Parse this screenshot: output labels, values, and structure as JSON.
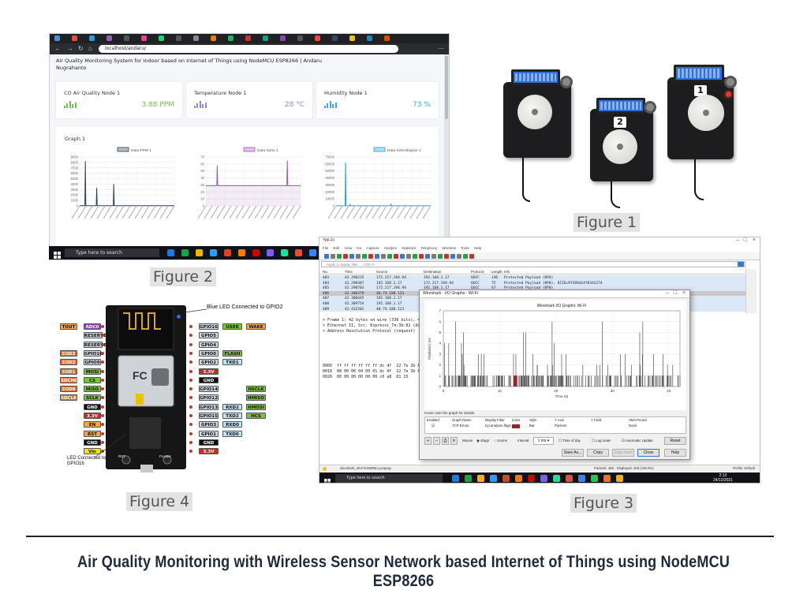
{
  "figure2": {
    "caption": "Figure 2",
    "url": "localhost/andaru/",
    "page_title": "Air Quality Monitoring System for Indoor based on Internet of Things using NodeMCU ESP8266 | Andaru Nugrahanto",
    "cards": [
      {
        "label": "CO Air Quality Node 1",
        "value": "3.88 PPM"
      },
      {
        "label": "Temperature Node 1",
        "value": "28 °C"
      },
      {
        "label": "Humidity Node 1",
        "value": "73 %"
      }
    ],
    "graph_panel_title": "Graph 1",
    "taskbar_search": "Type here to search"
  },
  "chart_data": [
    {
      "type": "line",
      "legend": "Data PPM 1",
      "color": "#2c3e50",
      "ylim": [
        0,
        9000
      ],
      "yticks": [
        0,
        1000,
        2000,
        3000,
        4000,
        5000,
        6000,
        7000,
        8000,
        9000
      ],
      "spikes": [
        [
          0.06,
          8200
        ],
        [
          0.18,
          3300
        ],
        [
          0.36,
          4000
        ]
      ],
      "baseline": 30
    },
    {
      "type": "line",
      "legend": "Data Suhu 1",
      "color": "#9b59b6",
      "ylim": [
        0,
        70
      ],
      "yticks": [
        0,
        10,
        20,
        30,
        40,
        50,
        60,
        70
      ],
      "spikes": [
        [
          0.12,
          58
        ],
        [
          0.86,
          65
        ]
      ],
      "baseline": 29
    },
    {
      "type": "line",
      "legend": "Data Kelembapan 1",
      "color": "#3498db",
      "ylim": [
        0,
        70000
      ],
      "yticks": [
        0,
        10000,
        20000,
        30000,
        40000,
        50000,
        60000,
        70000
      ],
      "spikes": [
        [
          0.1,
          62000
        ],
        [
          0.15,
          2000
        ],
        [
          0.58,
          3000
        ]
      ],
      "baseline": 80
    },
    {
      "type": "bar",
      "title": "Wireshark I/O Graphs: Wi-Fi",
      "ylabel": "Packets/1 ms",
      "xlabel": "Time (s)",
      "ylim": [
        0,
        7
      ],
      "xlim": [
        0,
        42
      ],
      "xticks": [
        0,
        10,
        20,
        30,
        40
      ],
      "yticks": [
        0,
        1,
        2,
        3,
        4,
        5,
        6,
        7
      ]
    }
  ],
  "figure1": {
    "caption": "Figure 1",
    "node_numbers": [
      "2",
      "1"
    ]
  },
  "figure3": {
    "caption": "Figure 3",
    "window_title": "*Wi-Fi",
    "menu": [
      "File",
      "Edit",
      "View",
      "Go",
      "Capture",
      "Analyze",
      "Statistics",
      "Telephony",
      "Wireless",
      "Tools",
      "Help"
    ],
    "filter_placeholder": "Apply a display filter ... <Ctrl-/>",
    "columns": [
      "No.",
      "Time",
      "Source",
      "Destination",
      "Protocol",
      "Length",
      "Info"
    ],
    "packets": [
      [
        "403",
        "42.290225",
        "172.217.194.94",
        "192.168.1.17",
        "QUIC",
        "146",
        "Protected Payload (KP0)"
      ],
      [
        "404",
        "42.290387",
        "192.168.1.17",
        "172.217.194.94",
        "QUIC",
        "75",
        "Protected Payload (KP0), DCID=9f389d24f8342274"
      ],
      [
        "405",
        "42.290703",
        "172.217.194.94",
        "192.168.1.17",
        "QUIC",
        "67",
        "Protected Payload (KP0)"
      ],
      [
        "406",
        "42.300379",
        "40.74.108.123",
        "",
        "",
        "",
        ""
      ],
      [
        "407",
        "42.300445",
        "192.168.1.17",
        "",
        "",
        "",
        ""
      ],
      [
        "408",
        "42.309754",
        "192.168.1.17",
        "",
        "",
        "",
        ""
      ],
      [
        "409",
        "42.432201",
        "40.74.108.123",
        "",
        "",
        "",
        ""
      ]
    ],
    "details": [
      "Frame 1: 42 bytes on wire (336 bits), 42",
      "Ethernet II, Src: Espressi_7e:3b:82 (dc",
      "Address Resolution Protocol (request)"
    ],
    "hex": [
      "0000  ff ff ff ff ff ff dc 4f  22 7e 3b 82",
      "0010  08 00 06 04 00 01 dc 4f  22 7e 3b 82",
      "0020  00 00 00 00 00 00 c0 a8  01 15"
    ],
    "io_window_title": "Wireshark · I/O Graphs · Wi-Fi",
    "hover_hint": "Hover over the graph for details.",
    "table_headers": [
      "Enabled",
      "Graph Name",
      "Display Filter",
      "Color",
      "Style",
      "Y Axis",
      "Y Field",
      "SMA Period"
    ],
    "table_row": {
      "name": "TCP Errors",
      "filter": "tcp.analysis.flags",
      "style": "Bar",
      "yaxis": "Packets",
      "sma": "None"
    },
    "controls": {
      "mouse": "Mouse",
      "drags": "drags",
      "zooms": "zooms",
      "interval_label": "Interval",
      "interval": "1 ms",
      "time_of_day": "Time of day",
      "log_scale": "Log scale",
      "auto_update": "Automatic Update",
      "reset": "Reset"
    },
    "buttons": [
      "Save As...",
      "Copy",
      "Copy from",
      "Close",
      "Help"
    ],
    "status_file": "wireshark_Wi-FiANWRE1.pcapng",
    "status_packets": "Packets: 458 · Displayed: 458 (100.0%)",
    "status_profile": "Profile: Default",
    "taskbar_search": "Type here to search",
    "clock_time": "2:13",
    "clock_date": "24/12/2021"
  },
  "figure4": {
    "caption": "Figure 4",
    "annot_blue_led": "Blue LED Connected to GPIO2",
    "annot_led16": "LED Connected to GPIO16",
    "left_pins": [
      {
        "labels": [
          "TOUT",
          "ADC0"
        ],
        "colors": [
          "#f2a64b",
          "#8e44ad"
        ]
      },
      {
        "labels": [
          "RESERVED"
        ],
        "colors": [
          "#cfd8e3"
        ]
      },
      {
        "labels": [
          "RESERVED"
        ],
        "colors": [
          "#cfd8e3"
        ]
      },
      {
        "labels": [
          "SDD3",
          "GPIO10"
        ],
        "colors": [
          "#e56a2c",
          "#cfd8e3"
        ]
      },
      {
        "labels": [
          "SDD2",
          "GPIO9"
        ],
        "colors": [
          "#e56a2c",
          "#cfd8e3"
        ]
      },
      {
        "labels": [
          "SDD1",
          "MOSI"
        ],
        "colors": [
          "#e56a2c",
          "#7ac143"
        ]
      },
      {
        "labels": [
          "SDCMD",
          "CS"
        ],
        "colors": [
          "#e56a2c",
          "#7ac143"
        ]
      },
      {
        "labels": [
          "SDD0",
          "MISO"
        ],
        "colors": [
          "#e56a2c",
          "#7ac143"
        ]
      },
      {
        "labels": [
          "SDCLK",
          "SCLK"
        ],
        "colors": [
          "#e56a2c",
          "#7ac143"
        ]
      },
      {
        "labels": [
          "GND"
        ],
        "colors": [
          "#111111"
        ]
      },
      {
        "labels": [
          "3.3V"
        ],
        "colors": [
          "#d8261c"
        ]
      },
      {
        "labels": [
          "EN"
        ],
        "colors": [
          "#f2a64b"
        ]
      },
      {
        "labels": [
          "RST"
        ],
        "colors": [
          "#f2a64b"
        ]
      },
      {
        "labels": [
          "GND"
        ],
        "colors": [
          "#111111"
        ]
      },
      {
        "labels": [
          "Vin"
        ],
        "colors": [
          "#f2e600"
        ]
      }
    ],
    "right_pins": [
      {
        "labels": [
          "GPIO16",
          "USER",
          "WAKE"
        ],
        "colors": [
          "#cfd8e3",
          "#7ac143",
          "#f2a64b"
        ]
      },
      {
        "labels": [
          "GPIO5"
        ],
        "colors": [
          "#cfd8e3"
        ]
      },
      {
        "labels": [
          "GPIO4"
        ],
        "colors": [
          "#cfd8e3"
        ]
      },
      {
        "labels": [
          "GPIO0",
          "FLASH"
        ],
        "colors": [
          "#cfd8e3",
          "#7ac143"
        ]
      },
      {
        "labels": [
          "GPIO2",
          "TXD1"
        ],
        "colors": [
          "#cfd8e3",
          "#bfe3f7"
        ]
      },
      {
        "labels": [
          "3.3V"
        ],
        "colors": [
          "#d8261c"
        ]
      },
      {
        "labels": [
          "GND"
        ],
        "colors": [
          "#111111"
        ]
      },
      {
        "labels": [
          "GPIO14",
          "",
          "HSCLK"
        ],
        "colors": [
          "#cfd8e3",
          "",
          "#7ac143"
        ]
      },
      {
        "labels": [
          "GPIO12",
          "",
          "HMISO"
        ],
        "colors": [
          "#cfd8e3",
          "",
          "#7ac143"
        ]
      },
      {
        "labels": [
          "GPIO13",
          "RXD2",
          "HMOSI"
        ],
        "colors": [
          "#cfd8e3",
          "#bfe3f7",
          "#7ac143"
        ]
      },
      {
        "labels": [
          "GPIO15",
          "TXD2",
          "HCS"
        ],
        "colors": [
          "#cfd8e3",
          "#bfe3f7",
          "#7ac143"
        ]
      },
      {
        "labels": [
          "GPIO3",
          "RXD0"
        ],
        "colors": [
          "#cfd8e3",
          "#bfe3f7"
        ]
      },
      {
        "labels": [
          "GPIO1",
          "TXD0"
        ],
        "colors": [
          "#cfd8e3",
          "#bfe3f7"
        ]
      },
      {
        "labels": [
          "GND"
        ],
        "colors": [
          "#111111"
        ]
      },
      {
        "labels": [
          "3.3V"
        ],
        "colors": [
          "#d8261c"
        ]
      }
    ],
    "board_buttons": [
      "RST",
      "FLASH"
    ]
  },
  "main_title": "Air Quality Monitoring with Wireless Sensor Network based Internet of Things using NodeMCU ESP8266"
}
